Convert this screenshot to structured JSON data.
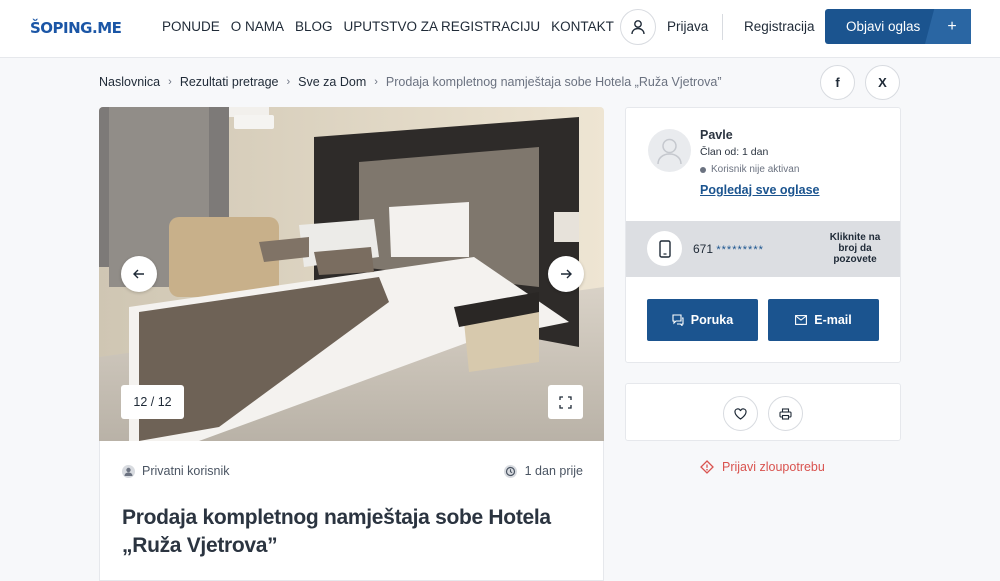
{
  "header": {
    "logo": "ŠOPING.ME",
    "nav": [
      "PONUDE",
      "O NAMA",
      "BLOG",
      "UPUTSTVO ZA REGISTRACIJU",
      "KONTAKT"
    ],
    "login": "Prijava",
    "register": "Registracija",
    "post_ad": "Objavi oglas",
    "post_ad_icon": "+"
  },
  "breadcrumb": {
    "items": [
      "Naslovnica",
      "Rezultati pretrage",
      "Sve za Dom"
    ],
    "current": "Prodaja kompletnog namještaja sobe Hotela „Ruža Vjetrova”"
  },
  "share": {
    "facebook": "f",
    "x": "X"
  },
  "gallery": {
    "counter": "12 / 12"
  },
  "listing": {
    "seller_type": "Privatni korisnik",
    "posted": "1 dan prije",
    "title": "Prodaja kompletnog namještaja sobe Hotela „Ruža Vjetrova”"
  },
  "seller": {
    "name": "Pavle",
    "member_since": "Član od: 1 dan",
    "status": "Korisnik nije aktivan",
    "all_ads": "Pogledaj sve oglase",
    "phone_prefix": "671",
    "phone_masked": "*********",
    "phone_hint": "Kliknite na broj da pozovete",
    "message_btn": "Poruka",
    "email_btn": "E-mail"
  },
  "report": "Prijavi zloupotrebu",
  "colors": {
    "primary": "#1b548f",
    "accent": "#f2a81d",
    "danger": "#d9534f"
  }
}
